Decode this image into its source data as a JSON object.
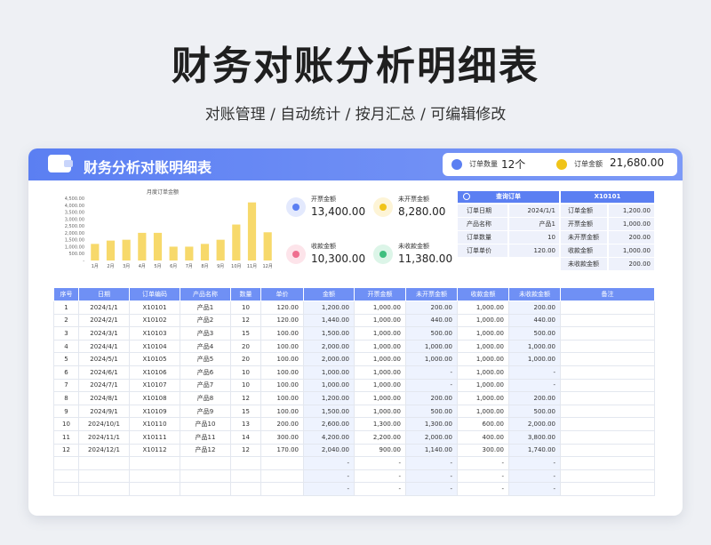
{
  "page": {
    "title": "财务对账分析明细表",
    "subtitle": "对账管理 / 自动统计 / 按月汇总 / 可编辑修改"
  },
  "sheet": {
    "title": "财务分析对账明细表",
    "header_stats": [
      {
        "label": "订单数量",
        "value": "12个",
        "icon": "order-icon",
        "color": "#5b7ff2"
      },
      {
        "label": "订单金额",
        "value": "21,680.00",
        "icon": "coin-icon",
        "color": "#f0c419"
      }
    ]
  },
  "chart_data": {
    "type": "bar",
    "title": "月度订单金额",
    "categories": [
      "1月",
      "2月",
      "3月",
      "4月",
      "5月",
      "6月",
      "7月",
      "8月",
      "9月",
      "10月",
      "11月",
      "12月"
    ],
    "values": [
      1200,
      1440,
      1500,
      2000,
      2000,
      1000,
      1000,
      1200,
      1500,
      2600,
      4200,
      2040
    ],
    "yticks": [
      "4,500.00",
      "4,000.00",
      "3,500.00",
      "3,000.00",
      "2,500.00",
      "2,000.00",
      "1,500.00",
      "1,000.00",
      "500.00",
      "-"
    ],
    "ylim": [
      0,
      4500
    ],
    "color": "#f7d96b"
  },
  "kpis": [
    {
      "label": "开票金额",
      "value": "13,400.00",
      "icon": "invoice-icon",
      "color": "#5b7ff2"
    },
    {
      "label": "未开票金额",
      "value": "8,280.00",
      "icon": "coin-icon",
      "color": "#f0c419"
    },
    {
      "label": "收款金额",
      "value": "10,300.00",
      "icon": "receive-icon",
      "color": "#ef6f8f"
    },
    {
      "label": "未收款金额",
      "value": "11,380.00",
      "icon": "money-icon",
      "color": "#3fbf7f"
    }
  ],
  "query": {
    "title": "查询订单",
    "order_id": "X10101",
    "left_rows": [
      {
        "label": "订单日期",
        "value": "2024/1/1"
      },
      {
        "label": "产品名称",
        "value": "产品1"
      },
      {
        "label": "订单数量",
        "value": "10"
      },
      {
        "label": "订单单价",
        "value": "120.00"
      }
    ],
    "right_rows": [
      {
        "label": "订单金额",
        "value": "1,200.00"
      },
      {
        "label": "开票金额",
        "value": "1,000.00"
      },
      {
        "label": "未开票金额",
        "value": "200.00"
      },
      {
        "label": "收款金额",
        "value": "1,000.00"
      },
      {
        "label": "未收款金额",
        "value": "200.00"
      }
    ]
  },
  "table": {
    "columns": [
      "序号",
      "日期",
      "订单编码",
      "产品名称",
      "数量",
      "单价",
      "金额",
      "开票金额",
      "未开票金额",
      "收款金额",
      "未收款金额",
      "备注"
    ],
    "rows": [
      [
        "1",
        "2024/1/1",
        "X10101",
        "产品1",
        "10",
        "120.00",
        "1,200.00",
        "1,000.00",
        "200.00",
        "1,000.00",
        "200.00",
        ""
      ],
      [
        "2",
        "2024/2/1",
        "X10102",
        "产品2",
        "12",
        "120.00",
        "1,440.00",
        "1,000.00",
        "440.00",
        "1,000.00",
        "440.00",
        ""
      ],
      [
        "3",
        "2024/3/1",
        "X10103",
        "产品3",
        "15",
        "100.00",
        "1,500.00",
        "1,000.00",
        "500.00",
        "1,000.00",
        "500.00",
        ""
      ],
      [
        "4",
        "2024/4/1",
        "X10104",
        "产品4",
        "20",
        "100.00",
        "2,000.00",
        "1,000.00",
        "1,000.00",
        "1,000.00",
        "1,000.00",
        ""
      ],
      [
        "5",
        "2024/5/1",
        "X10105",
        "产品5",
        "20",
        "100.00",
        "2,000.00",
        "1,000.00",
        "1,000.00",
        "1,000.00",
        "1,000.00",
        ""
      ],
      [
        "6",
        "2024/6/1",
        "X10106",
        "产品6",
        "10",
        "100.00",
        "1,000.00",
        "1,000.00",
        "-",
        "1,000.00",
        "-",
        ""
      ],
      [
        "7",
        "2024/7/1",
        "X10107",
        "产品7",
        "10",
        "100.00",
        "1,000.00",
        "1,000.00",
        "-",
        "1,000.00",
        "-",
        ""
      ],
      [
        "8",
        "2024/8/1",
        "X10108",
        "产品8",
        "12",
        "100.00",
        "1,200.00",
        "1,000.00",
        "200.00",
        "1,000.00",
        "200.00",
        ""
      ],
      [
        "9",
        "2024/9/1",
        "X10109",
        "产品9",
        "15",
        "100.00",
        "1,500.00",
        "1,000.00",
        "500.00",
        "1,000.00",
        "500.00",
        ""
      ],
      [
        "10",
        "2024/10/1",
        "X10110",
        "产品10",
        "13",
        "200.00",
        "2,600.00",
        "1,300.00",
        "1,300.00",
        "600.00",
        "2,000.00",
        ""
      ],
      [
        "11",
        "2024/11/1",
        "X10111",
        "产品11",
        "14",
        "300.00",
        "4,200.00",
        "2,200.00",
        "2,000.00",
        "400.00",
        "3,800.00",
        ""
      ],
      [
        "12",
        "2024/12/1",
        "X10112",
        "产品12",
        "12",
        "170.00",
        "2,040.00",
        "900.00",
        "1,140.00",
        "300.00",
        "1,740.00",
        ""
      ],
      [
        "",
        "",
        "",
        "",
        "",
        "",
        "-",
        "-",
        "-",
        "-",
        "-",
        ""
      ],
      [
        "",
        "",
        "",
        "",
        "",
        "",
        "-",
        "-",
        "-",
        "-",
        "-",
        ""
      ],
      [
        "",
        "",
        "",
        "",
        "",
        "",
        "-",
        "-",
        "-",
        "-",
        "-",
        ""
      ]
    ]
  }
}
